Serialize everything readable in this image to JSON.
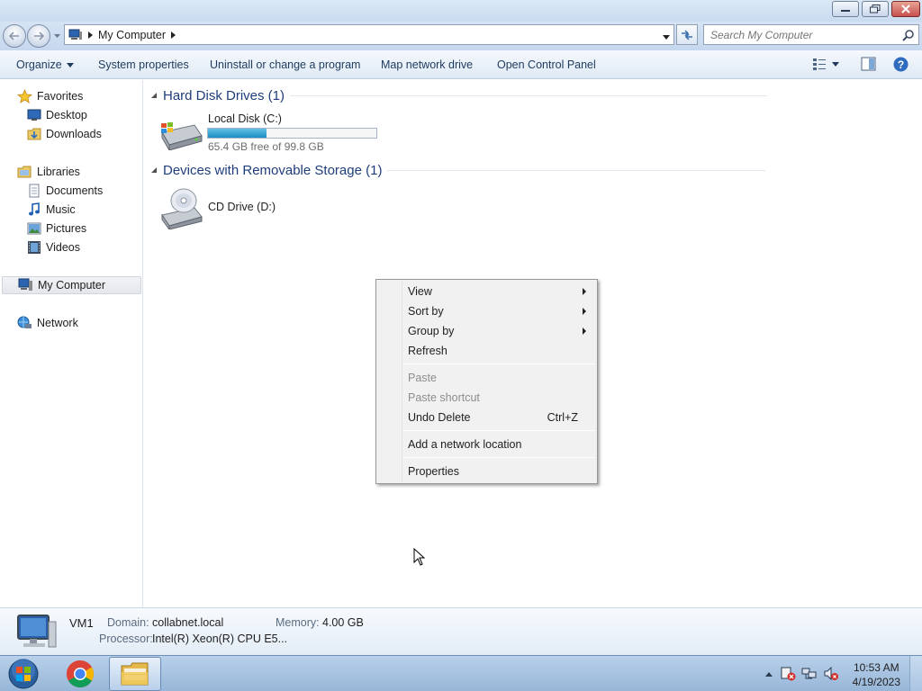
{
  "window": {
    "controls": [
      "minimize",
      "restore",
      "close"
    ]
  },
  "address": {
    "path": "My Computer",
    "search_placeholder": "Search My Computer"
  },
  "toolbar": {
    "organize": "Organize",
    "system_properties": "System properties",
    "uninstall": "Uninstall or change a program",
    "map_network_drive": "Map network drive",
    "open_control_panel": "Open Control Panel"
  },
  "nav": {
    "favorites": "Favorites",
    "desktop": "Desktop",
    "downloads": "Downloads",
    "libraries": "Libraries",
    "documents": "Documents",
    "music": "Music",
    "pictures": "Pictures",
    "videos": "Videos",
    "my_computer": "My Computer",
    "network": "Network"
  },
  "content": {
    "hdd_group": "Hard Disk Drives (1)",
    "local_disk": {
      "name": "Local Disk (C:)",
      "free_text": "65.4 GB free of 99.8 GB",
      "used_fraction": 0.345
    },
    "removable_group": "Devices with Removable Storage (1)",
    "cd_drive": "CD Drive (D:)"
  },
  "context_menu": {
    "view": "View",
    "sort_by": "Sort by",
    "group_by": "Group by",
    "refresh": "Refresh",
    "paste": "Paste",
    "paste_shortcut": "Paste shortcut",
    "undo_delete": "Undo Delete",
    "undo_delete_shortcut": "Ctrl+Z",
    "add_network_location": "Add a network location",
    "properties": "Properties"
  },
  "details": {
    "name": "VM1",
    "domain_label": "Domain:",
    "domain": "collabnet.local",
    "memory_label": "Memory:",
    "memory": "4.00 GB",
    "processor_label": "Processor:",
    "processor": "Intel(R) Xeon(R) CPU E5..."
  },
  "taskbar": {
    "time": "10:53 AM",
    "date": "4/19/2023"
  },
  "colors": {
    "capacity_fill": "#26a0da",
    "group_header": "#1e3d7a"
  }
}
